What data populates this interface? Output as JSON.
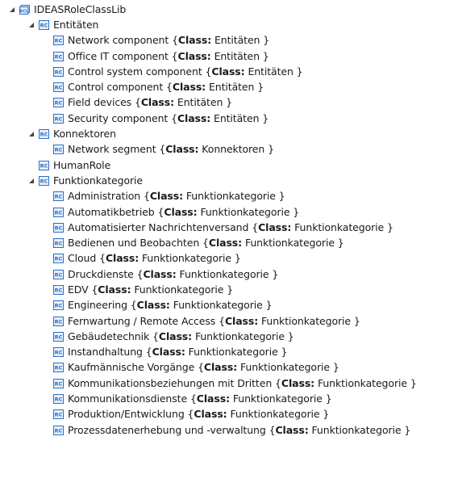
{
  "class_prefix": "Class:",
  "root": {
    "label": "IDEASRoleClassLib",
    "icon": "role-class-lib-icon"
  },
  "groups": [
    {
      "label": "Entitäten",
      "children": [
        {
          "name": "Network component ",
          "cls": "Entitäten }"
        },
        {
          "name": "Office IT component ",
          "cls": "Entitäten }"
        },
        {
          "name": "Control system component ",
          "cls": "Entitäten }"
        },
        {
          "name": "Control component ",
          "cls": "Entitäten }"
        },
        {
          "name": "Field devices ",
          "cls": "Entitäten }"
        },
        {
          "name": "Security component ",
          "cls": "Entitäten }"
        }
      ]
    },
    {
      "label": "Konnektoren",
      "children": [
        {
          "name": "Network segment ",
          "cls": "Konnektoren }"
        }
      ]
    },
    {
      "label": "HumanRole",
      "children": []
    },
    {
      "label": "Funktionkategorie",
      "children": [
        {
          "name": "Administration ",
          "cls": "Funktionkategorie }"
        },
        {
          "name": "Automatikbetrieb ",
          "cls": "Funktionkategorie }"
        },
        {
          "name": "Automatisierter Nachrichtenversand ",
          "cls": "Funktionkategorie }"
        },
        {
          "name": "Bedienen und Beobachten ",
          "cls": "Funktionkategorie }"
        },
        {
          "name": "Cloud ",
          "cls": "Funktionkategorie }"
        },
        {
          "name": "Druckdienste ",
          "cls": "Funktionkategorie }"
        },
        {
          "name": "EDV ",
          "cls": "Funktionkategorie }"
        },
        {
          "name": "Engineering ",
          "cls": "Funktionkategorie }"
        },
        {
          "name": "Fernwartung / Remote Access ",
          "cls": "Funktionkategorie }"
        },
        {
          "name": "Gebäudetechnik ",
          "cls": "Funktionkategorie }"
        },
        {
          "name": "Instandhaltung ",
          "cls": "Funktionkategorie }"
        },
        {
          "name": "Kaufmännische Vorgänge ",
          "cls": "Funktionkategorie }"
        },
        {
          "name": "Kommunikationsbeziehungen mit Dritten ",
          "cls": "Funktionkategorie }"
        },
        {
          "name": "Kommunikationsdienste ",
          "cls": "Funktionkategorie }"
        },
        {
          "name": "Produktion/Entwicklung ",
          "cls": "Funktionkategorie }"
        },
        {
          "name": "Prozessdatenerhebung und -verwaltung ",
          "cls": "Funktionkategorie }"
        }
      ]
    }
  ],
  "colors": {
    "icon_blue": "#2a6fc9",
    "icon_fill": "#e8f0fb",
    "toggle": "#444444"
  }
}
